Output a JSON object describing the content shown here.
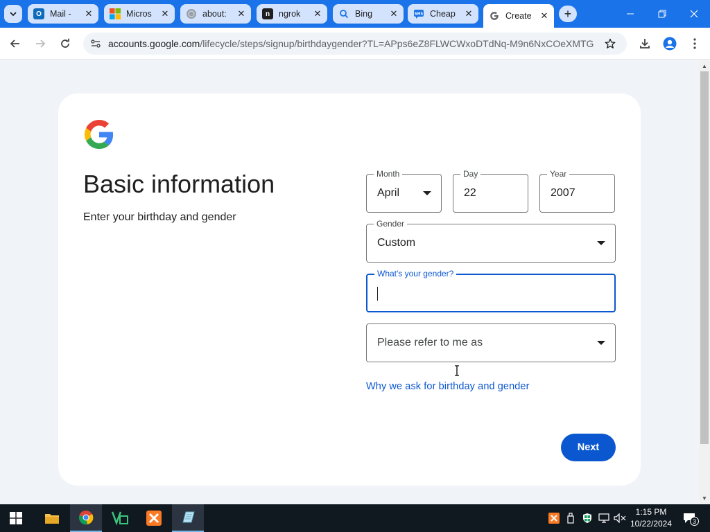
{
  "browser": {
    "tabs": [
      {
        "label": "Mail - ",
        "favicon": "outlook-icon",
        "color": "#0f6cbd"
      },
      {
        "label": "Micros",
        "favicon": "microsoft-icon",
        "color": "#f25022"
      },
      {
        "label": "about:",
        "favicon": "globe-icon",
        "color": "#9aa0a6"
      },
      {
        "label": "ngrok",
        "favicon": "ngrok-icon",
        "color": "#1f1f1f"
      },
      {
        "label": "Bing",
        "favicon": "search-icon",
        "color": "#1a73e8"
      },
      {
        "label": "Cheap",
        "favicon": "sms-icon",
        "color": "#1a73e8"
      },
      {
        "label": "Create",
        "favicon": "google-icon",
        "color": "#4285f4"
      }
    ],
    "active_tab_index": 6,
    "url_host": "accounts.google.com",
    "url_path": "/lifecycle/steps/signup/birthdaygender?TL=APps6eZ8FLWCWxoDTdNq-M9n6NxCOeXMTG..."
  },
  "form": {
    "heading": "Basic information",
    "subheading": "Enter your birthday and gender",
    "month": {
      "label": "Month",
      "value": "April"
    },
    "day": {
      "label": "Day",
      "value": "22"
    },
    "year": {
      "label": "Year",
      "value": "2007"
    },
    "gender": {
      "label": "Gender",
      "value": "Custom"
    },
    "custom_gender": {
      "label": "What's your gender?",
      "value": ""
    },
    "pronoun": {
      "placeholder": "Please refer to me as"
    },
    "why_link": "Why we ask for birthday and gender",
    "next_button": "Next"
  },
  "taskbar": {
    "apps": [
      "windows-start-icon",
      "file-explorer-icon",
      "chrome-icon",
      "veeam-icon",
      "xampp-icon",
      "notepad-icon"
    ],
    "time": "1:15 PM",
    "date": "10/22/2024",
    "notification_count": "3"
  },
  "colors": {
    "accent": "#0b57d0",
    "tabstrip": "#1a73e8",
    "page_bg": "#f0f4f9"
  }
}
